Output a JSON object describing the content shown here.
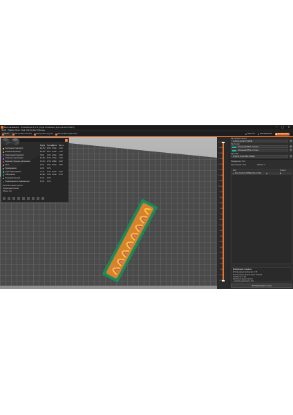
{
  "window": {
    "title": "Без названия - PrusaSlicer-2.7.0 (подготовлено для печати Mix3)",
    "minimize": "—",
    "maximize": "▢",
    "close": "✕"
  },
  "menu": [
    "Файл",
    "Правка",
    "Окно",
    "Вид",
    "Настройки",
    "Помощь"
  ],
  "tabs": [
    {
      "label": "Стол",
      "active": true
    },
    {
      "label": "Настройки печати",
      "active": false
    },
    {
      "label": "Настройки прутка",
      "active": false
    },
    {
      "label": "Настройки принтера",
      "active": false
    }
  ],
  "modes": [
    {
      "label": "Простой",
      "active": false
    },
    {
      "label": "Расширенный",
      "active": false
    },
    {
      "label": "Экспертный",
      "active": true
    }
  ],
  "legend": {
    "title": "Легенда",
    "subtitle": "Тип линии",
    "columns": [
      "Время",
      "Процент",
      "Длина",
      "Масса"
    ],
    "rows": [
      {
        "name": "Внутренний периметр",
        "color": "#f5c43a",
        "time": "26.73с",
        "pct": "4.0%",
        "len": "0.34м",
        "mass": "1.02г"
      },
      {
        "name": "Внешний периметр",
        "color": "#e8822e",
        "time": "44.10с",
        "pct": "6.6%",
        "len": "0.44м",
        "mass": "1.32г"
      },
      {
        "name": "Нависающий периметр",
        "color": "#3d5cc7",
        "time": "0.02с",
        "pct": "0.0%",
        "len": "0.00м",
        "mass": "0.00г"
      },
      {
        "name": "Сплошное заполнение",
        "color": "#b03da8",
        "time": "42.25с",
        "pct": "6.3%",
        "len": "0.34м",
        "mass": "1.01г"
      },
      {
        "name": "Верхнее сплошное заполнение",
        "color": "#e83b3b",
        "time": "15.27с",
        "pct": "2.3%",
        "len": "0.08м",
        "mass": "0.24г"
      },
      {
        "name": "Мост",
        "color": "#7a9ad9",
        "time": "4.18с",
        "pct": "0.6%",
        "len": "0.02м",
        "mass": "0.05г"
      },
      {
        "name": "Перемещение",
        "color": "#8a8a8a",
        "time": "1.22с",
        "pct": "0.2%",
        "len": "",
        "mass": ""
      },
      {
        "name": "Очистка/вытирание",
        "color": "#3aaa3a",
        "time": "1.73с",
        "pct": "0.3%",
        "len": "0.01м",
        "mass": "0.03г"
      },
      {
        "name": "Юбка/кайма",
        "color": "#1a8a5a",
        "time": "26.49с",
        "pct": "3.9%",
        "len": "0.24м",
        "mass": "0.72г"
      },
      {
        "name": "Пользовательский",
        "color": "#4ab04a",
        "time": "1.21с",
        "pct": "0.2%",
        "len": "",
        "mass": ""
      },
      {
        "name": "Перемещение в подвешенном",
        "color": "#3a3a9a",
        "time": "1.19с",
        "pct": "0.2%",
        "len": "",
        "mass": ""
      }
    ],
    "footer1": "Расчётное время печати:",
    "footer2": "Нормальный режим",
    "footer3": "Общее",
    "footer4": "11м"
  },
  "vslider": {
    "ticks": [
      "15.00",
      "14.40",
      "13.80",
      "13.20",
      "12.60",
      "12.00",
      "11.40",
      "10.80",
      "10.20",
      "9.60",
      "9.00",
      "8.40",
      "7.80",
      "7.20",
      "6.60",
      "6.00",
      "5.40",
      "4.80",
      "4.20",
      "3.60",
      "3.00",
      "2.40",
      "1.80",
      "1.20",
      "0.60",
      "0.20"
    ],
    "top_label": "15.00",
    "bottom_label": "0.20"
  },
  "hslider": {
    "left": "0",
    "right": "4502"
  },
  "rightpanel": {
    "print_label": "Настройки печати",
    "print_value": "0.15mm QUALITY @MINI",
    "filament_label": "Пруток(и):",
    "filament1": "Сплошной PETG от Prusa",
    "filament2": "Сплошной PETG от Prusa",
    "printer_label": "Принтер:",
    "printer_value": "Original Prusa MINI & MINI+",
    "supports_label": "Поддержки:",
    "supports_value": "Нет",
    "infill_label": "Заполнение:",
    "infill_value": "15%",
    "brim_label": "Кайма:",
    "list_header_name": "Имя",
    "list_header_editing": "Правка",
    "object_name": "Ring_holder3_ATHENA_Mini_V4.STL"
  },
  "info": {
    "title": "Информация о нарезке",
    "used_filament_m": "Использовано прутка (м): 1.73",
    "used_filament_mm3": "Использовано прутка (мм³): 4170.05",
    "cost_label": "Стоимость: 0.00",
    "time_label": "Расчётное время печати:",
    "normal_mode": "- нормальный режим: 11м"
  },
  "export_button": "Экспортировать G-код",
  "colors": {
    "accent": "#e8722a",
    "background": "#2b2b2b",
    "bed": "#9a9a9a"
  }
}
